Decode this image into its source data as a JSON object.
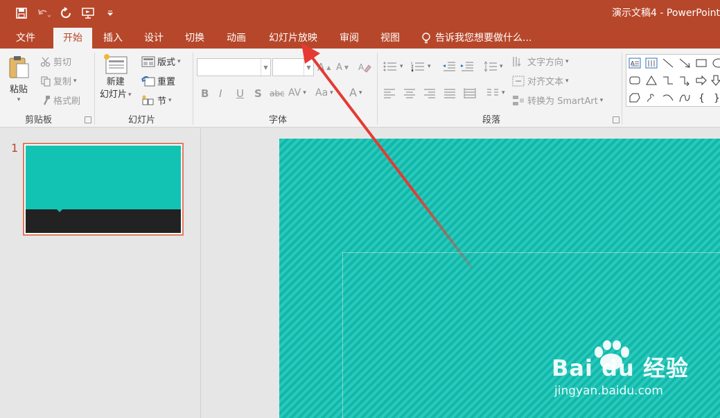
{
  "app": {
    "title": "演示文稿4 - PowerPoint",
    "accent": "#b7472a"
  },
  "quick_access": [
    "save-icon",
    "undo-icon",
    "redo-icon",
    "present-icon",
    "customize-icon"
  ],
  "tabs": [
    "文件",
    "开始",
    "插入",
    "设计",
    "切换",
    "动画",
    "幻灯片放映",
    "审阅",
    "视图"
  ],
  "active_tab": "开始",
  "tell_me": "告诉我您想要做什么...",
  "ribbon": {
    "clipboard": {
      "label": "剪贴板",
      "paste": "粘贴",
      "cut": "剪切",
      "copy": "复制",
      "format_painter": "格式刷"
    },
    "slides": {
      "label": "幻灯片",
      "new_slide_line1": "新建",
      "new_slide_line2": "幻灯片",
      "layout": "版式",
      "reset": "重置",
      "section": "节"
    },
    "font": {
      "label": "字体",
      "bold": "B",
      "italic": "I",
      "underline": "U",
      "shadow": "S",
      "strike": "abc",
      "spacing": "AV",
      "case": "Aa",
      "grow": "A",
      "shrink": "A"
    },
    "paragraph": {
      "label": "段落",
      "text_direction": "文字方向",
      "align_text": "对齐文本",
      "smartart": "转换为 SmartArt"
    }
  },
  "slides_pane": {
    "slide_number": "1",
    "thumb_colors": {
      "top": "#12c3b4",
      "band": "#222222"
    }
  },
  "slide": {
    "background": "#12c3b4"
  },
  "watermark": {
    "brand": "Bai du 经验",
    "url": "jingyan.baidu.com"
  }
}
